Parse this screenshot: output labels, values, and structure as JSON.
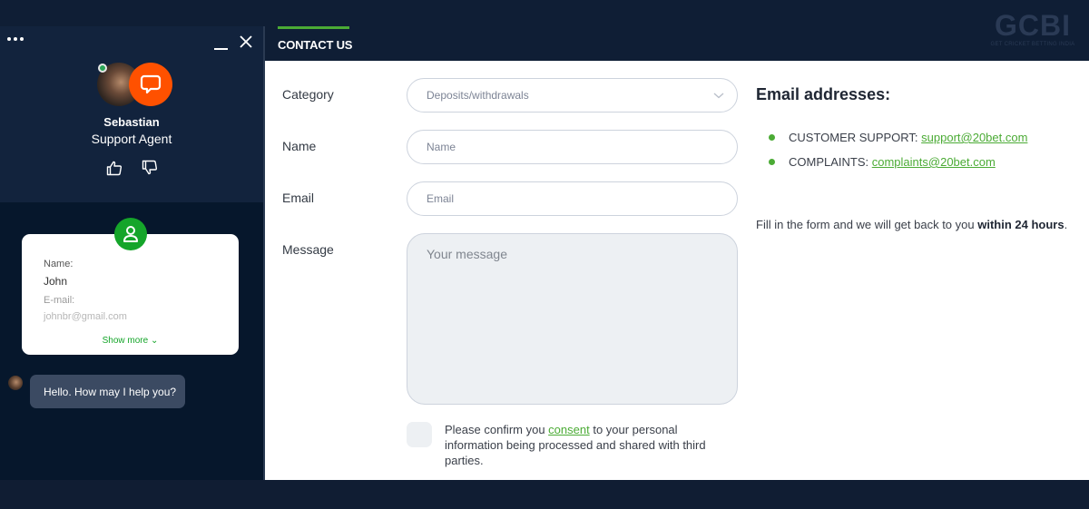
{
  "watermark": {
    "logo": "GCBI",
    "tagline": "GET CRICKET BETTING INDIA"
  },
  "tabs": [
    {
      "label": "CONTACT US",
      "active": true
    }
  ],
  "colors": {
    "accent": "#4bab35",
    "brand_orange": "#ff5100",
    "dark_navy": "#0f1e35"
  },
  "chat": {
    "menu_icon": "more-dots-icon",
    "minimize_icon": "minimize-icon",
    "close_icon": "close-icon",
    "agent": {
      "name": "Sebastian",
      "role": "Support Agent",
      "status": "online"
    },
    "rating": {
      "up_icon": "thumbs-up-icon",
      "down_icon": "thumbs-down-icon"
    },
    "user_card": {
      "icon": "user-icon",
      "name_label": "Name:",
      "name_value": "John",
      "email_label": "E-mail:",
      "email_value": "johnbr@gmail.com",
      "show_more": "Show more"
    },
    "messages": [
      {
        "from": "agent",
        "text": "Hello. How may I help you?"
      }
    ]
  },
  "form": {
    "category": {
      "label": "Category",
      "value": "Deposits/withdrawals"
    },
    "name": {
      "label": "Name",
      "placeholder": "Name"
    },
    "email": {
      "label": "Email",
      "placeholder": "Email"
    },
    "message": {
      "label": "Message",
      "placeholder": "Your message"
    },
    "consent": {
      "prefix": "Please confirm you ",
      "link": "consent",
      "suffix": " to your personal information being processed and shared with third parties.",
      "checked": false
    }
  },
  "contact_info": {
    "title": "Email addresses:",
    "emails": [
      {
        "label": "CUSTOMER SUPPORT: ",
        "address": "support@20bet.com"
      },
      {
        "label": "COMPLAINTS: ",
        "address": "complaints@20bet.com"
      }
    ],
    "note_prefix": "Fill in the form and we will get back to you ",
    "note_bold": "within 24 hours",
    "note_suffix": "."
  }
}
